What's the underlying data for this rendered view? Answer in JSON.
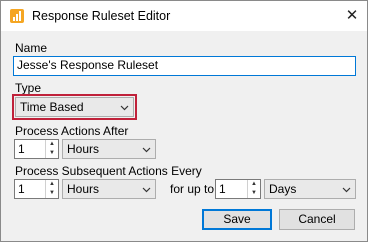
{
  "window": {
    "title": "Response Ruleset Editor",
    "close_glyph": "✕",
    "app_icon": "chart-bars-icon"
  },
  "form": {
    "name_label": "Name",
    "name_value": "Jesse's Response Ruleset",
    "type_label": "Type",
    "type_value": "Time Based",
    "after_label": "Process Actions After",
    "after_count": "1",
    "after_unit": "Hours",
    "every_label": "Process Subsequent Actions Every",
    "every_count": "1",
    "every_unit": "Hours",
    "upto_label": "for up to",
    "upto_count": "1",
    "upto_unit": "Days"
  },
  "buttons": {
    "save": "Save",
    "cancel": "Cancel"
  },
  "colors": {
    "accent": "#0078d7",
    "highlight": "#c0213a",
    "icon": "#f5a623"
  }
}
